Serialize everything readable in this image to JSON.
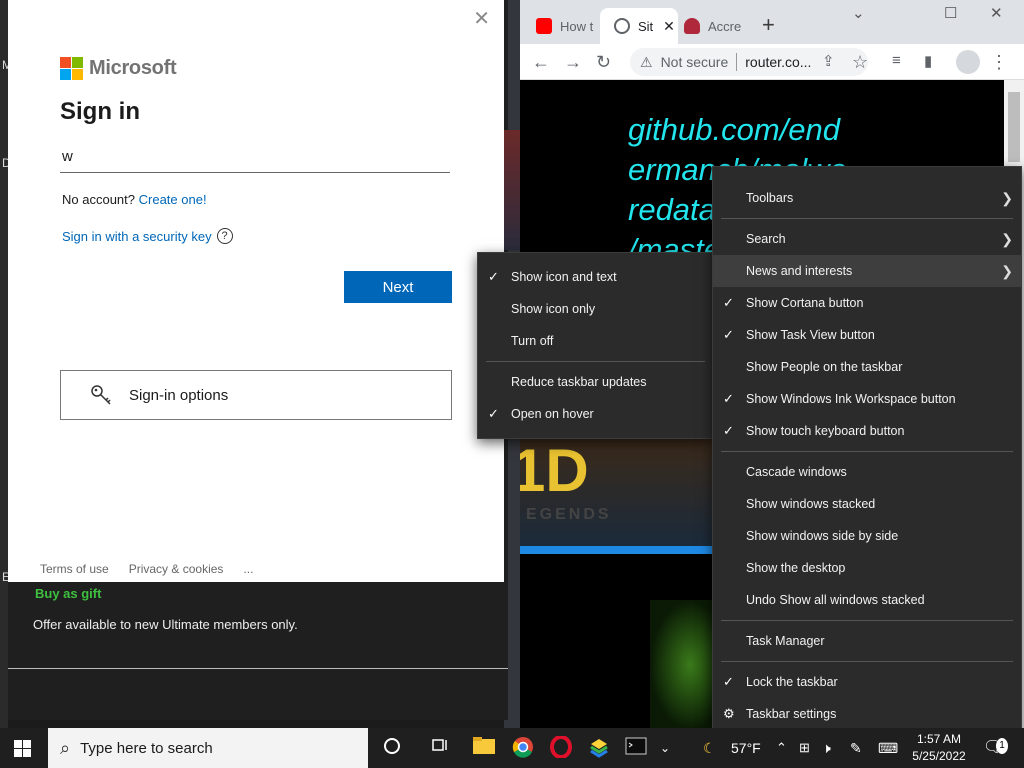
{
  "signin": {
    "brand": "Microsoft",
    "title": "Sign in",
    "input_value": "w",
    "no_account_text": "No account?",
    "create_link": "Create one!",
    "security_key_link": "Sign in with a security key",
    "help_glyph": "?",
    "next_label": "Next",
    "options_label": "Sign-in options",
    "close_glyph": "✕",
    "footer": {
      "terms": "Terms of use",
      "privacy": "Privacy & cookies",
      "more": "..."
    },
    "logo_colors": [
      "#f25022",
      "#7fba00",
      "#00a4ef",
      "#ffb900"
    ]
  },
  "store": {
    "gift_label": "Buy as gift",
    "offer_text": "Offer available to new Ultimate members only."
  },
  "desktop": {
    "labels": [
      "M",
      "D",
      "E"
    ]
  },
  "chrome": {
    "tabs": [
      {
        "label": "How t",
        "favicon": "youtube-icon",
        "color": "#ff0000"
      },
      {
        "label": "Sit",
        "favicon": "globe-icon",
        "color": "#5f6368"
      },
      {
        "label": "Accre",
        "favicon": "shield-icon",
        "color": "#b0283c"
      }
    ],
    "tab_close_glyph": "✕",
    "new_tab_glyph": "+",
    "window_controls": {
      "minimize": "⌄",
      "maximize": "☐",
      "close": "✕"
    },
    "address": {
      "security_text": "Not secure",
      "url": "router.co..."
    },
    "page_text_lines": [
      "github.com/end",
      "ermanch/malwa",
      "redata",
      "/maste"
    ],
    "game_title": "1D",
    "game_subtitle": "EGENDS"
  },
  "menu_main": {
    "items": [
      {
        "label": "Toolbars",
        "checked": false,
        "submenu": true
      },
      {
        "sep": true
      },
      {
        "label": "Search",
        "checked": false,
        "submenu": true
      },
      {
        "label": "News and interests",
        "checked": false,
        "submenu": true,
        "highlighted": true
      },
      {
        "label": "Show Cortana button",
        "checked": true
      },
      {
        "label": "Show Task View button",
        "checked": true
      },
      {
        "label": "Show People on the taskbar",
        "checked": false
      },
      {
        "label": "Show Windows Ink Workspace button",
        "checked": true
      },
      {
        "label": "Show touch keyboard button",
        "checked": true
      },
      {
        "sep": true
      },
      {
        "label": "Cascade windows",
        "checked": false
      },
      {
        "label": "Show windows stacked",
        "checked": false
      },
      {
        "label": "Show windows side by side",
        "checked": false
      },
      {
        "label": "Show the desktop",
        "checked": false
      },
      {
        "label": "Undo Show all windows stacked",
        "checked": false
      },
      {
        "sep": true
      },
      {
        "label": "Task Manager",
        "checked": false
      },
      {
        "sep": true
      },
      {
        "label": "Lock the taskbar",
        "checked": true
      },
      {
        "label": "Taskbar settings",
        "checked": false,
        "icon": "gear-icon"
      }
    ]
  },
  "menu_sub": {
    "items": [
      {
        "label": "Show icon and text",
        "checked": true
      },
      {
        "label": "Show icon only",
        "checked": false
      },
      {
        "label": "Turn off",
        "checked": false
      },
      {
        "sep": true
      },
      {
        "label": "Reduce taskbar updates",
        "checked": false
      },
      {
        "label": "Open on hover",
        "checked": true
      }
    ]
  },
  "glyphs": {
    "check": "✓",
    "submenu_arrow": "❯",
    "gear": "⚙"
  },
  "taskbar": {
    "search_placeholder": "Type here to search",
    "weather": "57°F",
    "time": "1:57 AM",
    "date": "5/25/2022",
    "notification_count": "1"
  }
}
